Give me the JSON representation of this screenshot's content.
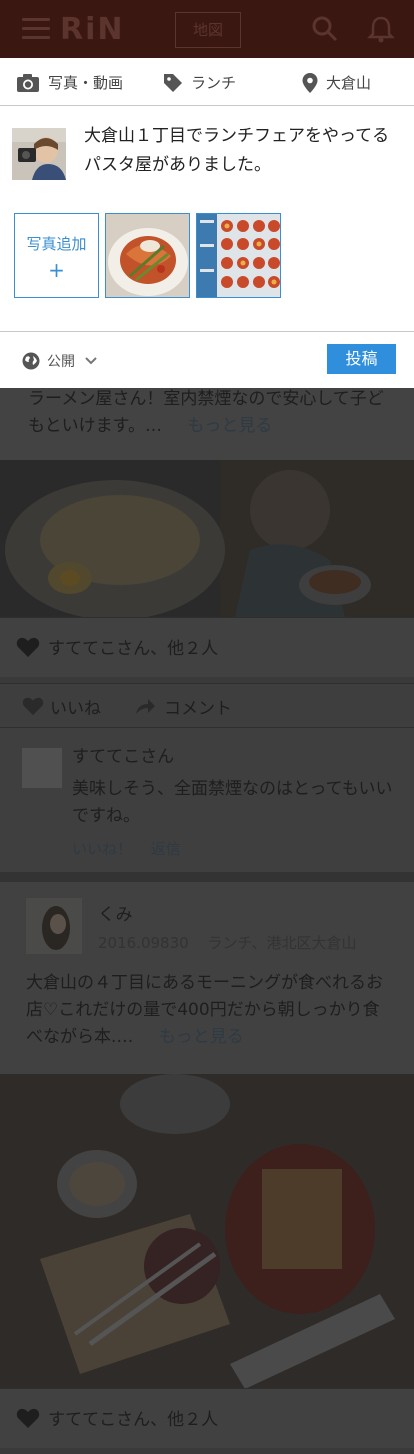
{
  "header": {
    "logo": "RiN",
    "map_label": "地図",
    "icons": [
      "menu-icon",
      "search-icon",
      "bell-icon"
    ]
  },
  "composer": {
    "meta": {
      "photo_label": "写真・動画",
      "tag_label": "ランチ",
      "location_label": "大倉山"
    },
    "text": "大倉山１丁目でランチフェアをやってるパスタ屋がありました。",
    "add_photo_label": "写真追加",
    "add_photo_plus": "+",
    "privacy_label": "公開",
    "post_label": "投稿"
  },
  "feed": {
    "post1": {
      "text": "ラーメン屋さん！室内禁煙なので安心して子どもといけます。…",
      "more": "もっと見る",
      "likes": "すててこさん、他２人",
      "like_action": "いいね",
      "comment_action": "コメント",
      "comment": {
        "author": "すててこさん",
        "text": "美味しそう、全面禁煙なのはとってもいいですね。",
        "like": "いいね！",
        "reply": "返信"
      }
    },
    "post2": {
      "author": "くみ",
      "date": "2016.09830",
      "category": "ランチ、港北区大倉山",
      "text": "大倉山の４丁目にあるモーニングが食べれるお店♡これだけの量で400円だから朝しっかり食べながら本.…",
      "more": "もっと見る",
      "likes": "すててこさん、他２人"
    }
  },
  "colors": {
    "accent": "#2f8fdc",
    "header_bg": "#3b1712"
  }
}
